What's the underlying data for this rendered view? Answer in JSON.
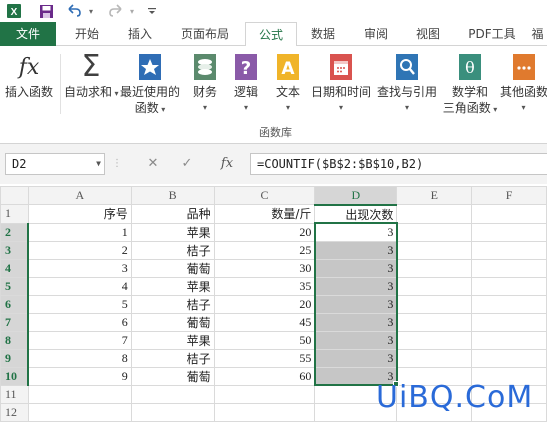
{
  "qat": {
    "save_icon": "save-icon",
    "undo_icon": "undo-icon",
    "redo_icon": "redo-icon",
    "customize_icon": "customize-qat-icon"
  },
  "tabs": [
    {
      "label": "文件",
      "kind": "file"
    },
    {
      "label": "开始",
      "kind": "normal"
    },
    {
      "label": "插入",
      "kind": "normal"
    },
    {
      "label": "页面布局",
      "kind": "normal"
    },
    {
      "label": "公式",
      "kind": "active"
    },
    {
      "label": "数据",
      "kind": "normal"
    },
    {
      "label": "审阅",
      "kind": "normal"
    },
    {
      "label": "视图",
      "kind": "normal"
    },
    {
      "label": "PDF工具",
      "kind": "normal"
    },
    {
      "label": "福",
      "kind": "normal"
    }
  ],
  "ribbon": {
    "insert_function": "插入函数",
    "autosum": "自动求和",
    "recent_line1": "最近使用的",
    "recent_line2": "函数",
    "financial": "财务",
    "logical": "逻辑",
    "text": "文本",
    "datetime": "日期和时间",
    "lookup": "查找与引用",
    "math_line1": "数学和",
    "math_line2": "三角函数",
    "more": "其他函数",
    "group_label": "函数库",
    "colors": {
      "autosum": "#404040",
      "recent": "#2f6db5",
      "financial": "#5b8a6d",
      "logical": "#8a5aa8",
      "text": "#f0b429",
      "datetime": "#d9534f",
      "lookup": "#2f75b5",
      "math": "#3a8f7d",
      "more": "#e07a2e"
    }
  },
  "formula_bar": {
    "name_box": "D2",
    "cancel_glyph": "✕",
    "enter_glyph": "✓",
    "fx_label": "fx",
    "formula": "=COUNTIF($B$2:$B$10,B2)"
  },
  "sheet": {
    "columns": [
      "A",
      "B",
      "C",
      "D",
      "E",
      "F"
    ],
    "selected_column": "D",
    "header_row": {
      "A": "序号",
      "B": "品种",
      "C": "数量/斤",
      "D": "出现次数"
    },
    "rows": [
      {
        "a": "1",
        "b": "苹果",
        "c": "20",
        "d": "3"
      },
      {
        "a": "2",
        "b": "桔子",
        "c": "25",
        "d": "3"
      },
      {
        "a": "3",
        "b": "葡萄",
        "c": "30",
        "d": "3"
      },
      {
        "a": "4",
        "b": "苹果",
        "c": "35",
        "d": "3"
      },
      {
        "a": "5",
        "b": "桔子",
        "c": "20",
        "d": "3"
      },
      {
        "a": "6",
        "b": "葡萄",
        "c": "45",
        "d": "3"
      },
      {
        "a": "7",
        "b": "苹果",
        "c": "50",
        "d": "3"
      },
      {
        "a": "8",
        "b": "桔子",
        "c": "55",
        "d": "3"
      },
      {
        "a": "9",
        "b": "葡萄",
        "c": "60",
        "d": "3"
      }
    ],
    "row_numbers": [
      "1",
      "2",
      "3",
      "4",
      "5",
      "6",
      "7",
      "8",
      "9",
      "10",
      "11",
      "12"
    ],
    "accent": "#217346"
  },
  "watermark": "UiBQ.CoM"
}
